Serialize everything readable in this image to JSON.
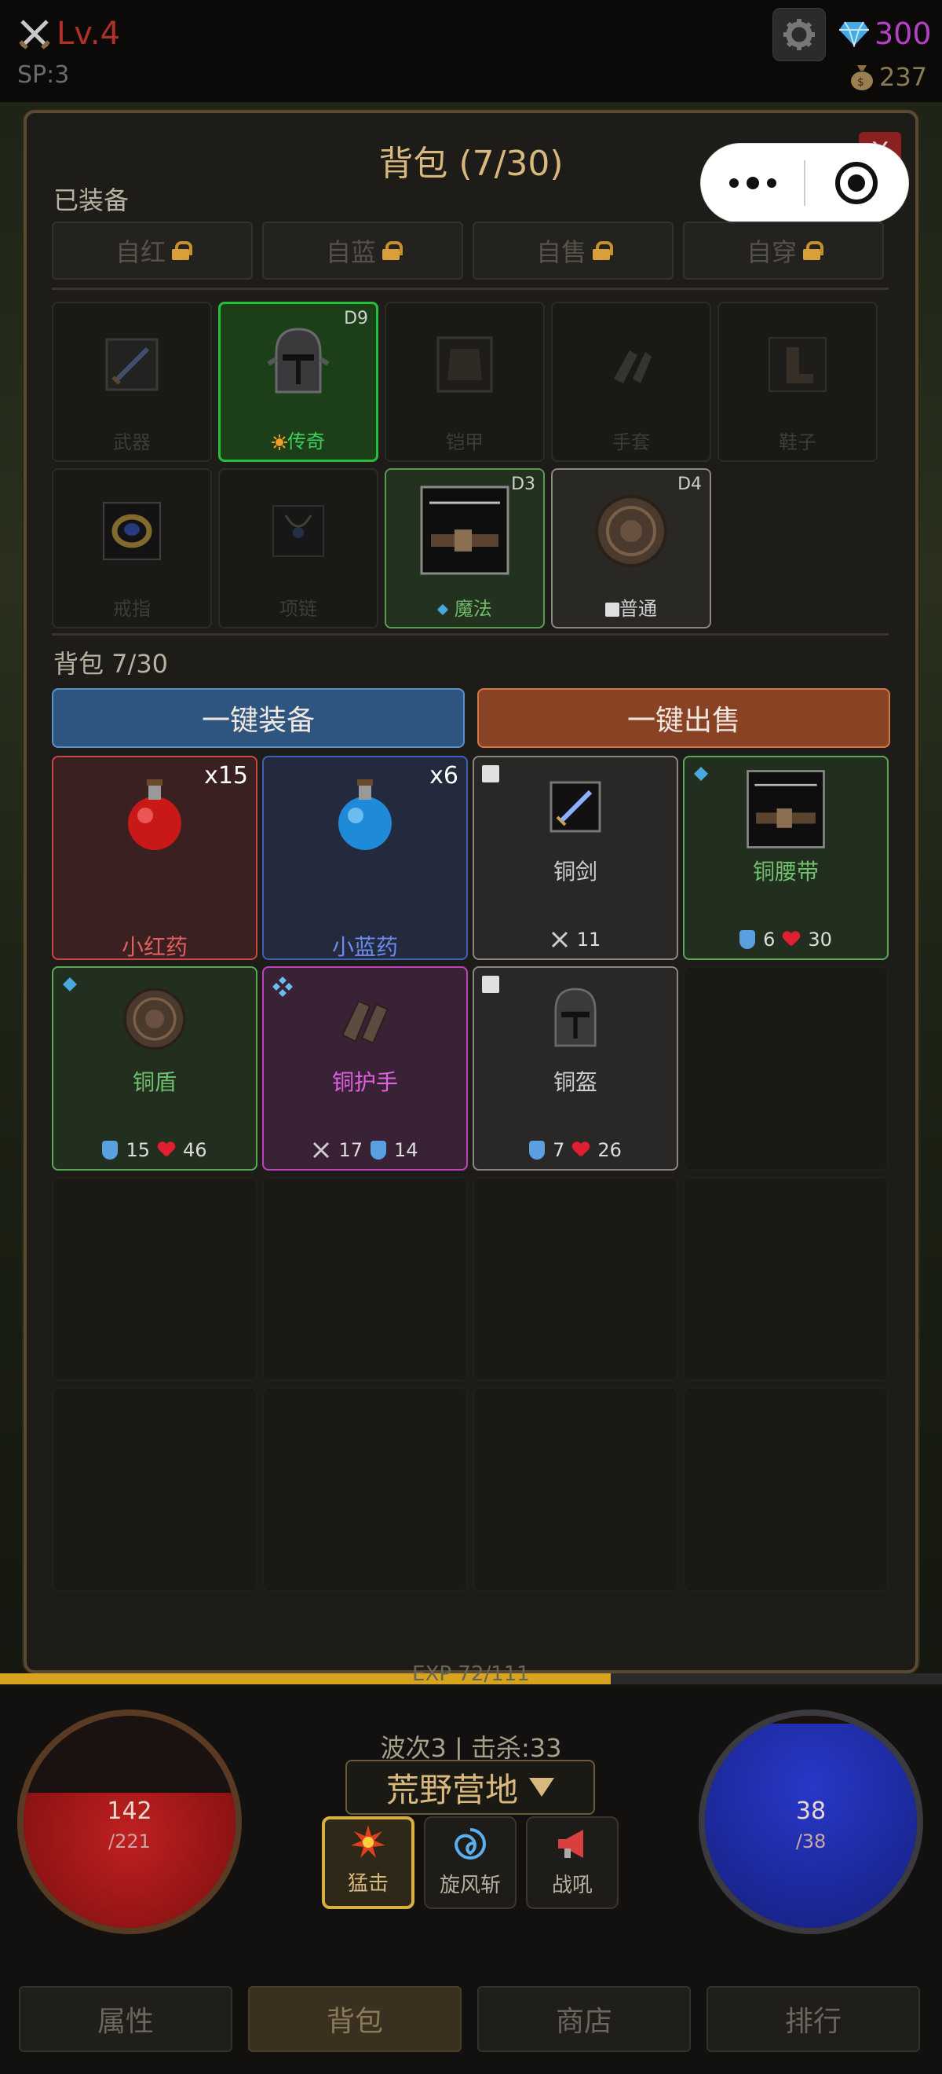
{
  "status": {
    "level": "Lv.4",
    "sp": "SP:3",
    "gems": "300",
    "gold": "237"
  },
  "panel": {
    "title": "背包 (7/30)",
    "close_label": "X",
    "equipped_label": "已装备",
    "auto_buttons": [
      "自红",
      "自蓝",
      "自售",
      "自穿"
    ],
    "slots": [
      {
        "label": "武器",
        "level": "",
        "state": "empty"
      },
      {
        "label": "传奇",
        "level": "D9",
        "state": "legend"
      },
      {
        "label": "铠甲",
        "level": "",
        "state": "empty"
      },
      {
        "label": "手套",
        "level": "",
        "state": "empty"
      },
      {
        "label": "鞋子",
        "level": "",
        "state": "empty"
      },
      {
        "label": "戒指",
        "level": "",
        "state": "empty"
      },
      {
        "label": "项链",
        "level": "",
        "state": "empty"
      },
      {
        "label": "魔法",
        "level": "D3",
        "state": "magic"
      },
      {
        "label": "普通",
        "level": "D4",
        "state": "normal"
      }
    ],
    "bag_label": "背包 7/30",
    "equip_all": "一键装备",
    "sell_all": "一键出售",
    "items": [
      {
        "name": "小红药",
        "qty": "x15"
      },
      {
        "name": "小蓝药",
        "qty": "x6"
      },
      {
        "name": "铜剑",
        "atk": "11"
      },
      {
        "name": "铜腰带",
        "def": "6",
        "hp": "30"
      },
      {
        "name": "铜盾",
        "def": "15",
        "hp": "46"
      },
      {
        "name": "铜护手",
        "atk": "17",
        "def": "14"
      },
      {
        "name": "铜盔",
        "def": "7",
        "hp": "26"
      }
    ]
  },
  "hud": {
    "exp": "EXP 72/111",
    "hp": "142",
    "hp_max": "/221",
    "mp": "38",
    "mp_max": "/38",
    "wave": "波次3 | 击杀:33",
    "map": "荒野营地",
    "skills": [
      "猛击",
      "旋风斩",
      "战吼"
    ]
  },
  "nav": [
    "属性",
    "背包",
    "商店",
    "排行"
  ],
  "colors": {
    "legend": "#22c03a",
    "magic": "#5a9a55",
    "hp": "#c02020",
    "mp": "#2838c8"
  }
}
